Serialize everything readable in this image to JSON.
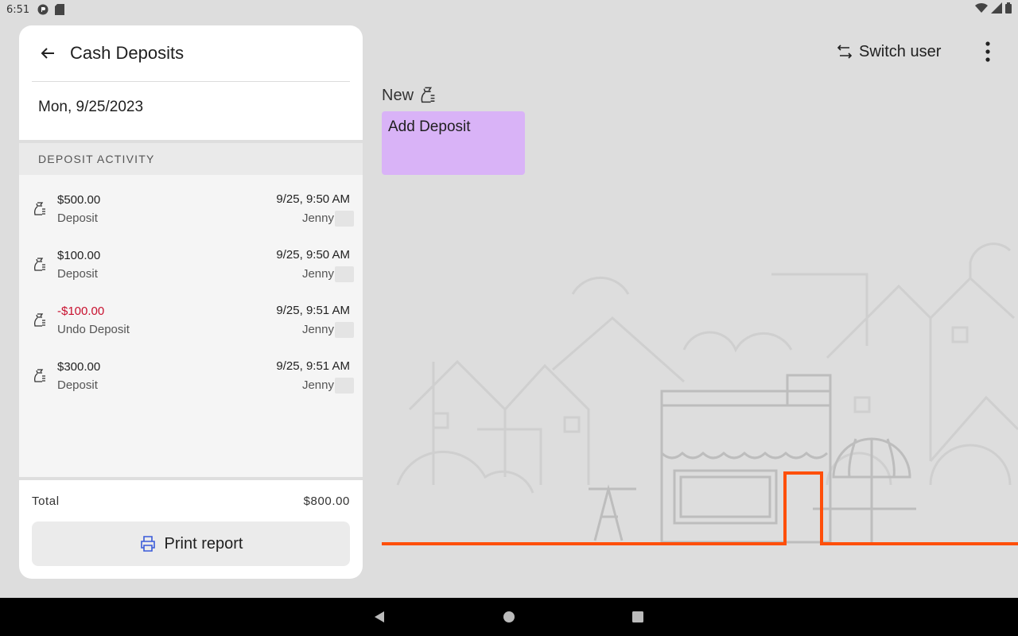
{
  "status_bar": {
    "time": "6:51"
  },
  "panel": {
    "title": "Cash Deposits",
    "date": "Mon, 9/25/2023",
    "section_header": "DEPOSIT ACTIVITY",
    "activities": [
      {
        "amount": "$500.00",
        "type": "Deposit",
        "time": "9/25, 9:50 AM",
        "user": "Jenny",
        "negative": false
      },
      {
        "amount": "$100.00",
        "type": "Deposit",
        "time": "9/25, 9:50 AM",
        "user": "Jenny",
        "negative": false
      },
      {
        "amount": "-$100.00",
        "type": "Undo Deposit",
        "time": "9/25, 9:51 AM",
        "user": "Jenny",
        "negative": true
      },
      {
        "amount": "$300.00",
        "type": "Deposit",
        "time": "9/25, 9:51 AM",
        "user": "Jenny",
        "negative": false
      }
    ],
    "total_label": "Total",
    "total_value": "$800.00",
    "print_label": "Print report"
  },
  "toolbar": {
    "switch_user_label": "Switch user"
  },
  "main": {
    "new_label": "New",
    "add_deposit_label": "Add Deposit"
  },
  "colors": {
    "accent_tile": "#d9b3f7",
    "negative": "#c8102e",
    "print_icon": "#3a5bd9",
    "illustration_line": "#ff4f0a"
  },
  "icons": {
    "back": "arrow-left-icon",
    "deposit": "money-bag-icon",
    "print": "printer-icon",
    "switch_user": "swap-arrows-icon",
    "overflow": "more-vert-icon"
  }
}
